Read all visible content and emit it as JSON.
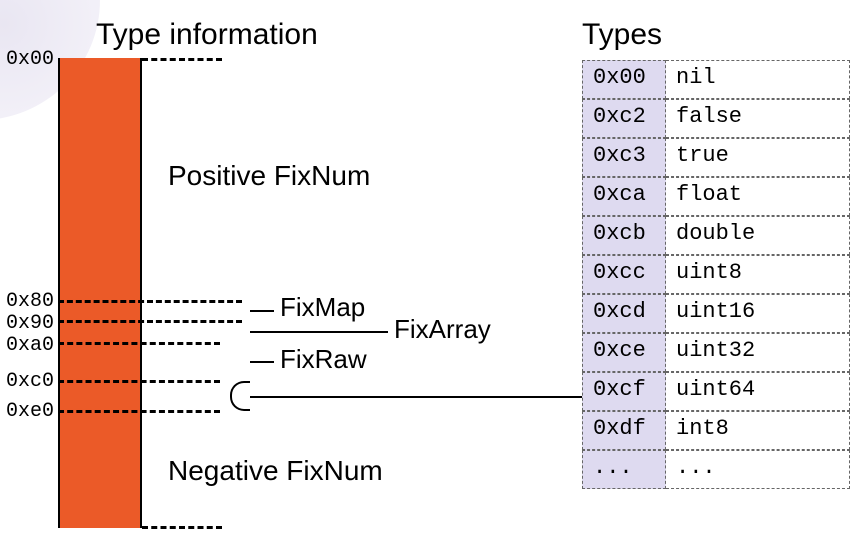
{
  "titles": {
    "left": "Type information",
    "right": "Types"
  },
  "bar": {
    "color": "#eb5a28",
    "positive_label": "Positive FixNum",
    "negative_label": "Negative FixNum"
  },
  "addresses": {
    "a0": "0x00",
    "a1": "0x80",
    "a2": "0x90",
    "a3": "0xa0",
    "a4": "0xc0",
    "a5": "0xe0"
  },
  "segments": {
    "fixmap": "FixMap",
    "fixarray": "FixArray",
    "fixraw": "FixRaw"
  },
  "types": [
    {
      "code": "0x00",
      "name": "nil"
    },
    {
      "code": "0xc2",
      "name": "false"
    },
    {
      "code": "0xc3",
      "name": "true"
    },
    {
      "code": "0xca",
      "name": "float"
    },
    {
      "code": "0xcb",
      "name": "double"
    },
    {
      "code": "0xcc",
      "name": "uint8"
    },
    {
      "code": "0xcd",
      "name": "uint16"
    },
    {
      "code": "0xce",
      "name": "uint32"
    },
    {
      "code": "0xcf",
      "name": "uint64"
    },
    {
      "code": "0xdf",
      "name": "int8"
    },
    {
      "code": "...",
      "name": "..."
    }
  ]
}
